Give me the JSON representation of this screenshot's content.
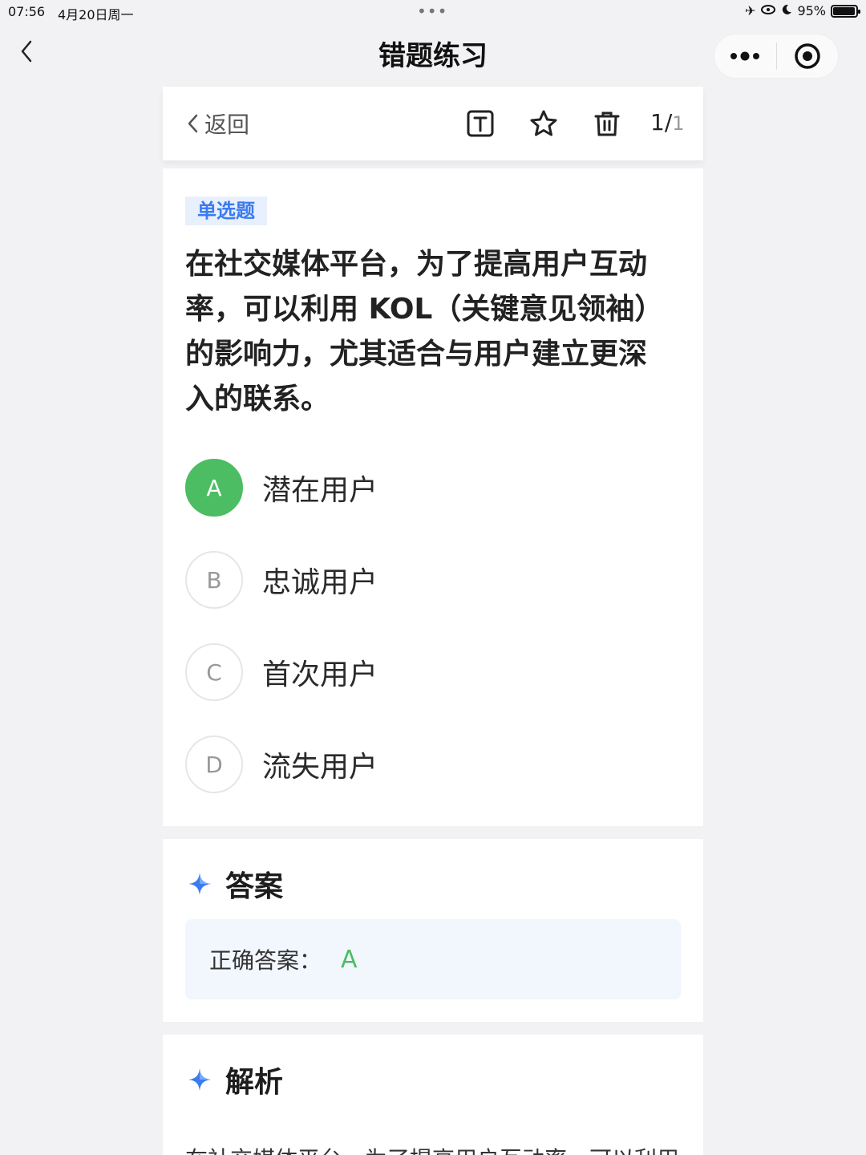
{
  "status_bar": {
    "time": "07:56",
    "date": "4月20日周一",
    "battery": "95%",
    "battery_level": 0.95
  },
  "nav": {
    "title": "错题练习"
  },
  "toolbar": {
    "back_label": "返回",
    "page_current": "1/",
    "page_total": "1"
  },
  "question": {
    "type_tag": "单选题",
    "text": "在社交媒体平台，为了提高用户互动率，可以利用 KOL（关键意见领袖）的影响力，尤其适合与用户建立更深入的联系。",
    "options": [
      {
        "letter": "A",
        "text": "潜在用户"
      },
      {
        "letter": "B",
        "text": "忠诚用户"
      },
      {
        "letter": "C",
        "text": "首次用户"
      },
      {
        "letter": "D",
        "text": "流失用户"
      }
    ]
  },
  "answer": {
    "title": "答案",
    "label": "正确答案：",
    "value": "A"
  },
  "analysis": {
    "title": "解析",
    "text": "在社交媒体平台，为了提高用户互动率，可以利用"
  },
  "colors": {
    "correct": "#4cbd62",
    "accent": "#3a7bf0",
    "tag_bg": "#e8f0fd",
    "answer_bg": "#f2f6fd"
  }
}
